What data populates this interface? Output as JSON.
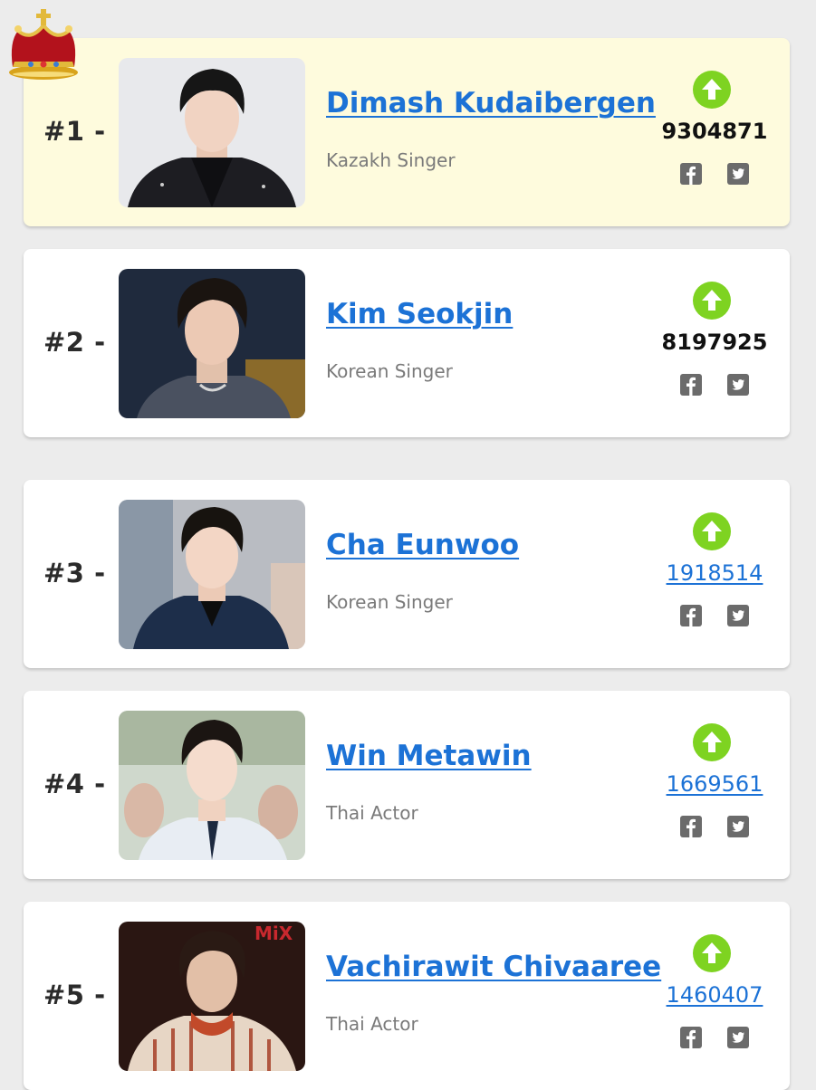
{
  "colors": {
    "link_blue": "#1c72d6",
    "vote_green": "#7ed321",
    "top_card_bg": "#fefbdd",
    "card_bg": "#ffffff",
    "page_bg": "#ececec"
  },
  "icons": {
    "crown": "crown-icon",
    "vote": "arrow-up-icon",
    "facebook": "facebook-icon",
    "twitter": "twitter-icon"
  },
  "entries": [
    {
      "rank": "#1 -",
      "name": "Dimash Kudaibergen",
      "description": "Kazakh Singer",
      "votes": "9304871"
    },
    {
      "rank": "#2 -",
      "name": "Kim Seokjin",
      "description": "Korean Singer",
      "votes": "8197925"
    },
    {
      "rank": "#3 -",
      "name": "Cha Eunwoo",
      "description": "Korean Singer",
      "votes": "1918514"
    },
    {
      "rank": "#4 -",
      "name": "Win Metawin",
      "description": "Thai Actor",
      "votes": "1669561"
    },
    {
      "rank": "#5 -",
      "name": "Vachirawit Chivaaree",
      "description": "Thai Actor",
      "votes": "1460407",
      "photo_label": "MiX"
    }
  ]
}
